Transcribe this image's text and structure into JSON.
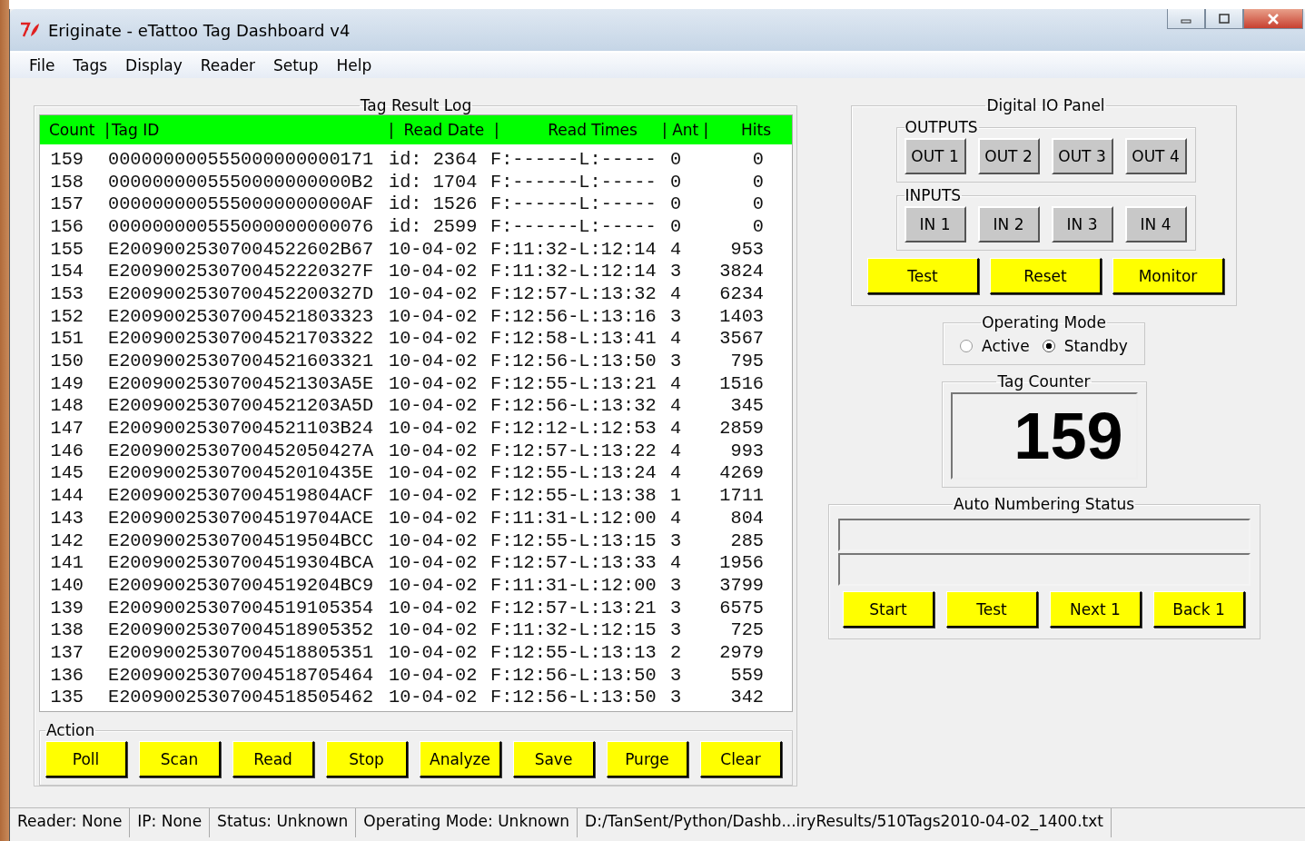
{
  "window": {
    "title": "Eriginate - eTattoo Tag Dashboard v4"
  },
  "menu": [
    "File",
    "Tags",
    "Display",
    "Reader",
    "Setup",
    "Help"
  ],
  "tag_result_log": {
    "title": "Tag Result Log",
    "columns": [
      "Count  |",
      "Tag ID",
      "|  Read Date  |",
      "Read Times",
      "| Ant |",
      "Hits"
    ],
    "rows": [
      {
        "count": "159",
        "tag_id": "000000000555000000000171",
        "read_date": "id: 2364",
        "read_times": "F:------L:-----",
        "ant": "0",
        "hits": "0"
      },
      {
        "count": "158",
        "tag_id": "0000000005550000000000B2",
        "read_date": "id: 1704",
        "read_times": "F:------L:-----",
        "ant": "0",
        "hits": "0"
      },
      {
        "count": "157",
        "tag_id": "0000000005550000000000AF",
        "read_date": "id: 1526",
        "read_times": "F:------L:-----",
        "ant": "0",
        "hits": "0"
      },
      {
        "count": "156",
        "tag_id": "000000000555000000000076",
        "read_date": "id: 2599",
        "read_times": "F:------L:-----",
        "ant": "0",
        "hits": "0"
      },
      {
        "count": "155",
        "tag_id": "E20090025307004522602B67",
        "read_date": "10-04-02",
        "read_times": "F:11:32-L:12:14",
        "ant": "4",
        "hits": "953"
      },
      {
        "count": "154",
        "tag_id": "E2009002530700452220327F",
        "read_date": "10-04-02",
        "read_times": "F:11:32-L:12:14",
        "ant": "3",
        "hits": "3824"
      },
      {
        "count": "153",
        "tag_id": "E2009002530700452200327D",
        "read_date": "10-04-02",
        "read_times": "F:12:57-L:13:32",
        "ant": "4",
        "hits": "6234"
      },
      {
        "count": "152",
        "tag_id": "E20090025307004521803323",
        "read_date": "10-04-02",
        "read_times": "F:12:56-L:13:16",
        "ant": "3",
        "hits": "1403"
      },
      {
        "count": "151",
        "tag_id": "E20090025307004521703322",
        "read_date": "10-04-02",
        "read_times": "F:12:58-L:13:41",
        "ant": "4",
        "hits": "3567"
      },
      {
        "count": "150",
        "tag_id": "E20090025307004521603321",
        "read_date": "10-04-02",
        "read_times": "F:12:56-L:13:50",
        "ant": "3",
        "hits": "795"
      },
      {
        "count": "149",
        "tag_id": "E20090025307004521303A5E",
        "read_date": "10-04-02",
        "read_times": "F:12:55-L:13:21",
        "ant": "4",
        "hits": "1516"
      },
      {
        "count": "148",
        "tag_id": "E20090025307004521203A5D",
        "read_date": "10-04-02",
        "read_times": "F:12:56-L:13:32",
        "ant": "4",
        "hits": "345"
      },
      {
        "count": "147",
        "tag_id": "E20090025307004521103B24",
        "read_date": "10-04-02",
        "read_times": "F:12:12-L:12:53",
        "ant": "4",
        "hits": "2859"
      },
      {
        "count": "146",
        "tag_id": "E2009002530700452050427A",
        "read_date": "10-04-02",
        "read_times": "F:12:57-L:13:22",
        "ant": "4",
        "hits": "993"
      },
      {
        "count": "145",
        "tag_id": "E2009002530700452010435E",
        "read_date": "10-04-02",
        "read_times": "F:12:55-L:13:24",
        "ant": "4",
        "hits": "4269"
      },
      {
        "count": "144",
        "tag_id": "E20090025307004519804ACF",
        "read_date": "10-04-02",
        "read_times": "F:12:55-L:13:38",
        "ant": "1",
        "hits": "1711"
      },
      {
        "count": "143",
        "tag_id": "E20090025307004519704ACE",
        "read_date": "10-04-02",
        "read_times": "F:11:31-L:12:00",
        "ant": "4",
        "hits": "804"
      },
      {
        "count": "142",
        "tag_id": "E20090025307004519504BCC",
        "read_date": "10-04-02",
        "read_times": "F:12:55-L:13:15",
        "ant": "3",
        "hits": "285"
      },
      {
        "count": "141",
        "tag_id": "E20090025307004519304BCA",
        "read_date": "10-04-02",
        "read_times": "F:12:57-L:13:33",
        "ant": "4",
        "hits": "1956"
      },
      {
        "count": "140",
        "tag_id": "E20090025307004519204BC9",
        "read_date": "10-04-02",
        "read_times": "F:11:31-L:12:00",
        "ant": "3",
        "hits": "3799"
      },
      {
        "count": "139",
        "tag_id": "E20090025307004519105354",
        "read_date": "10-04-02",
        "read_times": "F:12:57-L:13:21",
        "ant": "3",
        "hits": "6575"
      },
      {
        "count": "138",
        "tag_id": "E20090025307004518905352",
        "read_date": "10-04-02",
        "read_times": "F:11:32-L:12:15",
        "ant": "3",
        "hits": "725"
      },
      {
        "count": "137",
        "tag_id": "E20090025307004518805351",
        "read_date": "10-04-02",
        "read_times": "F:12:55-L:13:13",
        "ant": "2",
        "hits": "2979"
      },
      {
        "count": "136",
        "tag_id": "E20090025307004518705464",
        "read_date": "10-04-02",
        "read_times": "F:12:56-L:13:50",
        "ant": "3",
        "hits": "559"
      },
      {
        "count": "135",
        "tag_id": "E20090025307004518505462",
        "read_date": "10-04-02",
        "read_times": "F:12:56-L:13:50",
        "ant": "3",
        "hits": "342"
      }
    ]
  },
  "action": {
    "title": "Action",
    "buttons": [
      "Poll",
      "Scan",
      "Read",
      "Stop",
      "Analyze",
      "Save",
      "Purge",
      "Clear"
    ]
  },
  "digital_io_panel": {
    "title": "Digital IO Panel",
    "outputs": {
      "title": "OUTPUTS",
      "buttons": [
        "OUT 1",
        "OUT 2",
        "OUT 3",
        "OUT 4"
      ]
    },
    "inputs": {
      "title": "INPUTS",
      "buttons": [
        "IN 1",
        "IN 2",
        "IN 3",
        "IN 4"
      ]
    },
    "buttons": [
      "Test",
      "Reset",
      "Monitor"
    ]
  },
  "operating_mode": {
    "title": "Operating Mode",
    "options": [
      {
        "label": "Active",
        "selected": false
      },
      {
        "label": "Standby",
        "selected": true
      }
    ]
  },
  "tag_counter": {
    "title": "Tag Counter",
    "value": "159"
  },
  "auto_numbering_status": {
    "title": "Auto Numbering Status",
    "buttons": [
      "Start",
      "Test",
      "Next 1",
      "Back 1"
    ]
  },
  "status_bar": [
    "Reader: None",
    "IP: None",
    "Status: Unknown",
    "Operating Mode: Unknown",
    "D:/TanSent/Python/Dashb...iryResults/510Tags2010-04-02_1400.txt"
  ]
}
